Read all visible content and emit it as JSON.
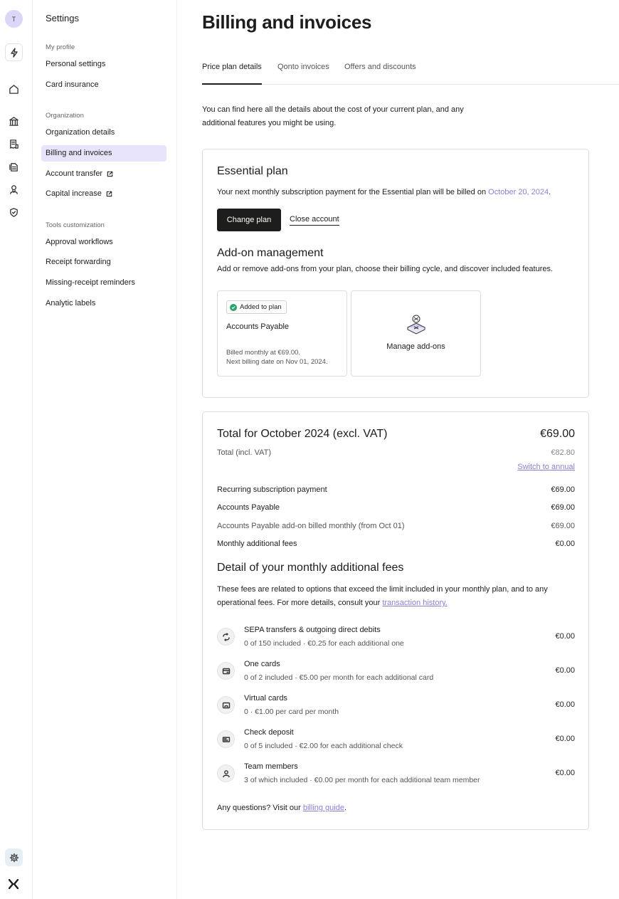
{
  "rail": {
    "avatar_initial": "T",
    "icons": [
      "bolt-icon",
      "home-icon",
      "bank-icon",
      "receipt-icon",
      "documents-icon",
      "team-icon",
      "shield-icon",
      "gear-icon",
      "qonto-logo"
    ]
  },
  "settings_nav": {
    "title": "Settings",
    "groups": [
      {
        "label": "My profile",
        "items": [
          "Personal settings",
          "Card insurance"
        ]
      },
      {
        "label": "Organization",
        "items": [
          "Organization details",
          "Billing and invoices",
          "Account transfer",
          "Capital increase"
        ]
      },
      {
        "label": "Tools customization",
        "items": [
          "Approval workflows",
          "Receipt forwarding",
          "Missing-receipt reminders",
          "Analytic labels"
        ]
      }
    ],
    "active_item": "Billing and invoices"
  },
  "page": {
    "title": "Billing and invoices",
    "tabs": [
      "Price plan details",
      "Qonto invoices",
      "Offers and discounts"
    ],
    "intro": "You can find here all the details about the cost of your current plan, and any additional features you might be using."
  },
  "plan": {
    "title": "Essential plan",
    "desc_prefix": "Your next monthly subscription payment for the Essential plan will be billed on ",
    "date": "October 20, 2024",
    "desc_suffix": ".",
    "change_button": "Change plan",
    "close_button": "Close account",
    "addon_title": "Add-on management",
    "addon_desc": "Add or remove add-ons from your plan, choose their billing cycle, and discover included features.",
    "addon_card": {
      "badge": "Added to plan",
      "name": "Accounts Payable",
      "billing_line1": "Billed monthly at €69.00.",
      "billing_line2": "Next billing date on Nov 01, 2024."
    },
    "manage_label": "Manage add-ons"
  },
  "total": {
    "title": "Total for October 2024 (excl. VAT)",
    "amount": "€69.00",
    "incl_label": "Total (incl. VAT)",
    "incl_amount": "€82.80",
    "switch_link": "Switch to annual",
    "lines": [
      {
        "label": "Recurring subscription payment",
        "value": "€69.00"
      },
      {
        "label": "Accounts Payable",
        "value": "€69.00"
      },
      {
        "label": "Accounts Payable add-on billed monthly (from Oct 01)",
        "value": "€69.00"
      },
      {
        "label": "Monthly additional fees",
        "value": "€0.00"
      }
    ],
    "detail_title": "Detail of your monthly additional fees",
    "detail_desc_1": "These fees are related to options that exceed the limit included in your monthly plan, and to any",
    "detail_desc_2": "operational fees. For more details, consult your ",
    "detail_link": "transaction history.",
    "fees": [
      {
        "icon": "transfer-icon",
        "name": "SEPA transfers & outgoing direct debits",
        "desc": "0 of 150 included · €0.25 for each additional one",
        "value": "€0.00"
      },
      {
        "icon": "card-icon",
        "name": "One cards",
        "desc": "0 of 2 included · €5.00 per month for each additional card",
        "value": "€0.00"
      },
      {
        "icon": "virtual-card-icon",
        "name": "Virtual cards",
        "desc": "0 · €1.00 per card per month",
        "value": "€0.00"
      },
      {
        "icon": "check-icon",
        "name": "Check deposit",
        "desc": "0 of 5 included · €2.00 for each additional check",
        "value": "€0.00"
      },
      {
        "icon": "user-icon",
        "name": "Team members",
        "desc": "3 of which included · €0.00 per month for each additional team member",
        "value": "€0.00"
      }
    ],
    "questions_prefix": "Any questions? Visit our ",
    "questions_link": "billing guide",
    "questions_suffix": "."
  }
}
